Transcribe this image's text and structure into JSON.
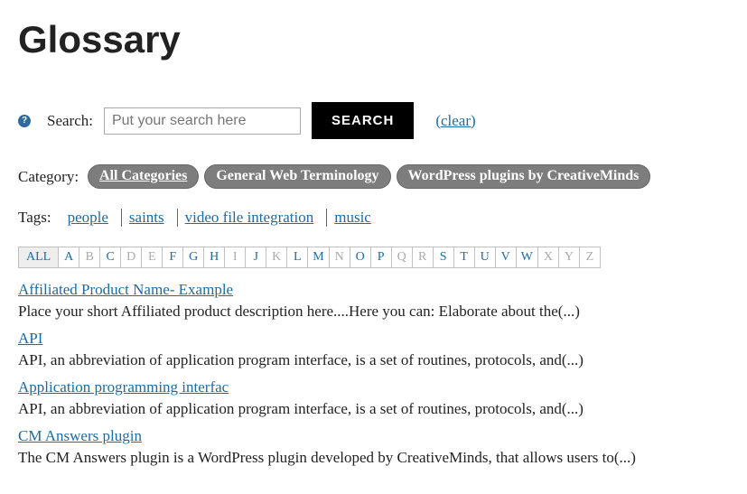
{
  "title": "Glossary",
  "search": {
    "label": "Search:",
    "placeholder": "Put your search here",
    "button": "SEARCH",
    "clear": "(clear)"
  },
  "category": {
    "label": "Category:",
    "items": [
      {
        "label": "All Categories",
        "active": true
      },
      {
        "label": "General Web Terminology",
        "active": false
      },
      {
        "label": "WordPress plugins by CreativeMinds",
        "active": false
      }
    ]
  },
  "tags": {
    "label": "Tags:",
    "items": [
      "people",
      "saints",
      "video file integration",
      "music"
    ]
  },
  "alpha": {
    "all": "ALL",
    "letters": [
      {
        "l": "A",
        "on": true
      },
      {
        "l": "B",
        "on": false
      },
      {
        "l": "C",
        "on": true
      },
      {
        "l": "D",
        "on": false
      },
      {
        "l": "E",
        "on": false
      },
      {
        "l": "F",
        "on": true
      },
      {
        "l": "G",
        "on": true
      },
      {
        "l": "H",
        "on": true
      },
      {
        "l": "I",
        "on": false
      },
      {
        "l": "J",
        "on": true
      },
      {
        "l": "K",
        "on": false
      },
      {
        "l": "L",
        "on": true
      },
      {
        "l": "M",
        "on": true
      },
      {
        "l": "N",
        "on": false
      },
      {
        "l": "O",
        "on": true
      },
      {
        "l": "P",
        "on": true
      },
      {
        "l": "Q",
        "on": false
      },
      {
        "l": "R",
        "on": false
      },
      {
        "l": "S",
        "on": true
      },
      {
        "l": "T",
        "on": true
      },
      {
        "l": "U",
        "on": true
      },
      {
        "l": "V",
        "on": true
      },
      {
        "l": "W",
        "on": true
      },
      {
        "l": "X",
        "on": false
      },
      {
        "l": "Y",
        "on": false
      },
      {
        "l": "Z",
        "on": false
      }
    ]
  },
  "entries": [
    {
      "title": "Affiliated Product Name- Example",
      "desc": "Place your short Affiliated product description here....Here you can: Elaborate about the(...)"
    },
    {
      "title": "API",
      "desc": "API, an abbreviation of application program interface, is a set of routines, protocols, and(...)"
    },
    {
      "title": "Application programming interfac",
      "desc": "API, an abbreviation of application program interface, is a set of routines, protocols, and(...)"
    },
    {
      "title": "CM Answers plugin",
      "desc": "The CM Answers plugin is a WordPress plugin developed by CreativeMinds, that allows users to(...)"
    }
  ]
}
